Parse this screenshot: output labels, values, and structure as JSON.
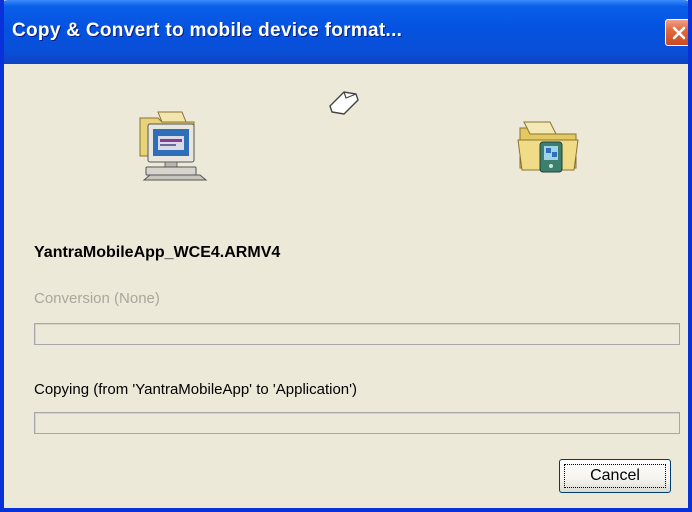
{
  "window": {
    "title": "Copy & Convert to mobile device format...",
    "close_icon": "close-icon",
    "titlebar_color": "#0a56e6",
    "close_color": "#e2693e"
  },
  "animation": {
    "source_icon": "desktop-computer-icon",
    "moving_icon": "document-icon",
    "target_icon": "device-folder-icon"
  },
  "file": {
    "name": "YantraMobileApp_WCE4.ARMV4"
  },
  "conversion": {
    "label": "Conversion (None)",
    "enabled": false,
    "progress": 0
  },
  "copying": {
    "label": "Copying (from 'YantraMobileApp' to 'Application')",
    "progress": 0
  },
  "buttons": {
    "cancel": "Cancel"
  }
}
